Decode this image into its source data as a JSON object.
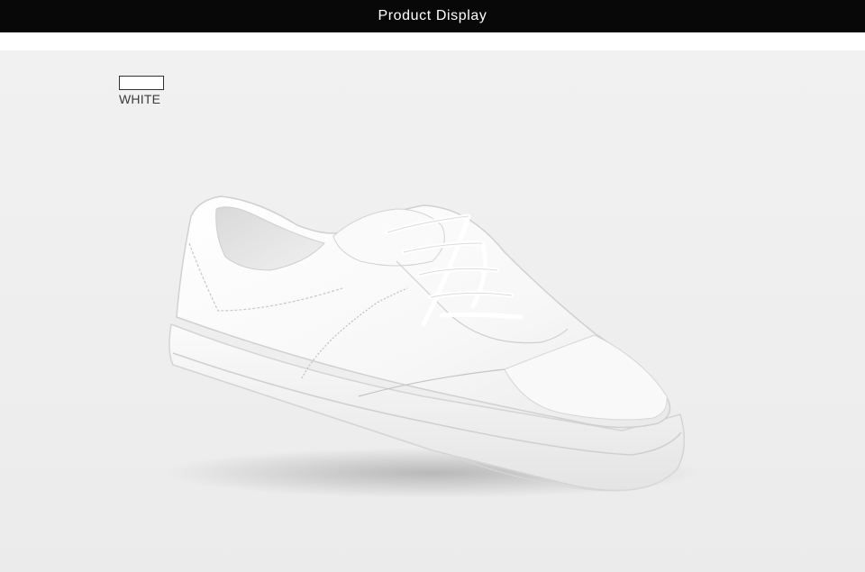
{
  "header": {
    "title": "Product Display"
  },
  "swatch": {
    "label": "WHITE",
    "color": "#ffffff"
  },
  "product_image": {
    "icon": "white-sneaker-image"
  },
  "colors": {
    "header_bg": "#080808",
    "header_text": "#ffffff",
    "photo_bg": "#eeeeee"
  }
}
